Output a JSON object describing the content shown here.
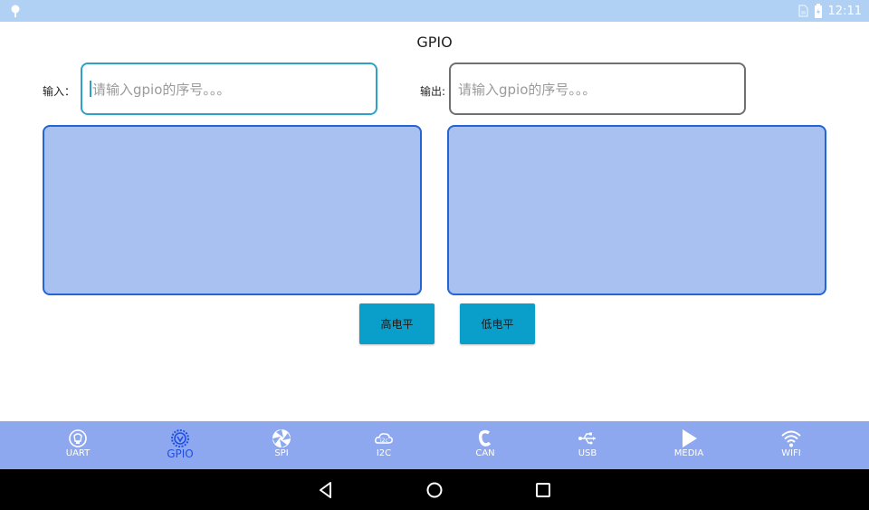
{
  "status_bar": {
    "time": "12:11",
    "left_icon": "notification-pin-icon",
    "right_icons": [
      "sim-icon",
      "battery-icon"
    ]
  },
  "page": {
    "title": "GPIO"
  },
  "input_section": {
    "label": "输入：",
    "placeholder": "请输入gpio的序号。。。"
  },
  "output_section": {
    "label": "输出:",
    "placeholder": "请输入gpio的序号。。。"
  },
  "buttons": {
    "high": "高电平",
    "low": "低电平"
  },
  "colors": {
    "status_bar": "#b0d0f4",
    "pane_fill": "#a9c1f1",
    "pane_border": "#2365d3",
    "button": "#0a9fcb",
    "tab_bar": "#8ea8f0",
    "tab_active": "#1f4fe0"
  },
  "tabs": [
    {
      "label": "UART",
      "icon": "uart-icon",
      "active": false
    },
    {
      "label": "GPIO",
      "icon": "gpio-icon",
      "active": true
    },
    {
      "label": "SPI",
      "icon": "spi-icon",
      "active": false
    },
    {
      "label": "I2C",
      "icon": "i2c-icon",
      "active": false
    },
    {
      "label": "CAN",
      "icon": "can-icon",
      "active": false
    },
    {
      "label": "USB",
      "icon": "usb-icon",
      "active": false
    },
    {
      "label": "MEDIA",
      "icon": "play-icon",
      "active": false
    },
    {
      "label": "WIFI",
      "icon": "wifi-icon",
      "active": false
    }
  ],
  "nav_bar": {
    "buttons": [
      "back-icon",
      "home-icon",
      "recents-icon"
    ]
  }
}
